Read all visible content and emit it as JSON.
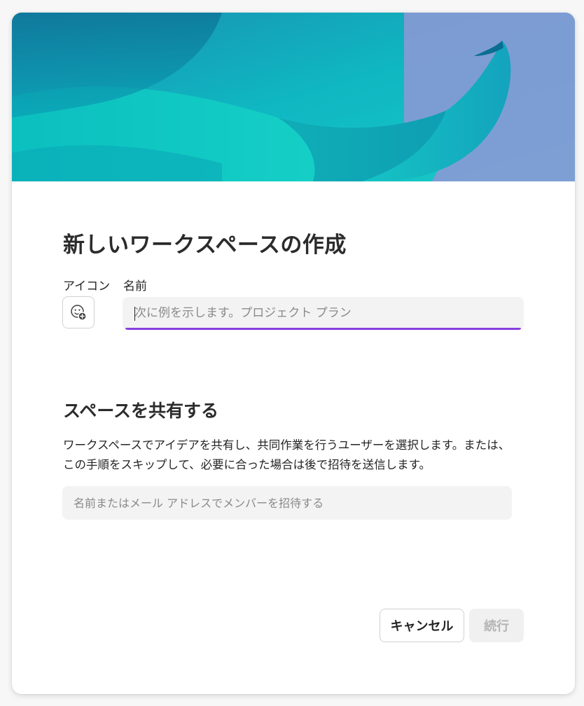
{
  "dialog": {
    "title": "新しいワークスペースの作成",
    "icon_label": "アイコン",
    "icon_button_icon": "emoji-add-icon",
    "name_label": "名前",
    "name_input": {
      "value": "",
      "placeholder": "次に例を示します。プロジェクト プラン"
    },
    "accent_color": "#8a3ee0",
    "share_section": {
      "title": "スペースを共有する",
      "description_line1": "ワークスペースでアイデアを共有し、共同作業を行うユーザーを選択します。または、",
      "description_line2": "この手順をスキップして、必要に合った場合は後で招待を送信します。",
      "invite_input": {
        "value": "",
        "placeholder": "名前またはメール アドレスでメンバーを招待する"
      }
    },
    "buttons": {
      "cancel": "キャンセル",
      "continue": "続行",
      "continue_disabled": true
    }
  }
}
